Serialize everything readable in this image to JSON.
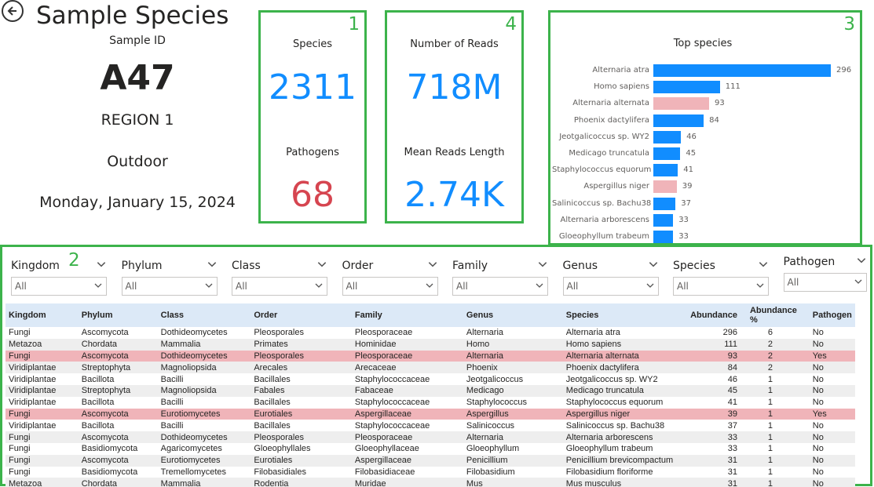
{
  "page": {
    "title": "Sample Species",
    "sample_id_label": "Sample ID",
    "sample_id": "A47",
    "region": "REGION 1",
    "environment": "Outdoor",
    "date": "Monday, January 15, 2024"
  },
  "cards": {
    "card1": {
      "number": "1",
      "species_label": "Species",
      "species_value": "2311",
      "pathogens_label": "Pathogens",
      "pathogens_value": "68"
    },
    "card4": {
      "number": "4",
      "reads_label": "Number of Reads",
      "reads_value": "718M",
      "length_label": "Mean Reads Length",
      "length_value": "2.74K"
    },
    "card3": {
      "number": "3"
    },
    "card2": {
      "number": "2"
    }
  },
  "colors": {
    "accent_green": "#3cb34b",
    "kpi_blue": "#118dff",
    "kpi_red": "#d64550",
    "bar_blue": "#118dff",
    "bar_pink": "#f0b4b9"
  },
  "chart_data": {
    "type": "bar",
    "orientation": "horizontal",
    "title": "Top species",
    "categories": [
      "Alternaria atra",
      "Homo sapiens",
      "Alternaria alternata",
      "Phoenix dactylifera",
      "Jeotgalicoccus sp. WY2",
      "Medicago truncatula",
      "Staphylococcus equorum",
      "Aspergillus niger",
      "Salinicoccus sp. Bachu38",
      "Alternaria arborescens",
      "Gloeophyllum trabeum"
    ],
    "values": [
      296,
      111,
      93,
      84,
      46,
      45,
      41,
      39,
      37,
      33,
      33
    ],
    "pathogen": [
      false,
      false,
      true,
      false,
      false,
      false,
      false,
      true,
      false,
      false,
      false
    ],
    "xlim": [
      0,
      296
    ]
  },
  "slicers": [
    {
      "label": "Kingdom",
      "value": "All"
    },
    {
      "label": "Phylum",
      "value": "All"
    },
    {
      "label": "Class",
      "value": "All"
    },
    {
      "label": "Order",
      "value": "All"
    },
    {
      "label": "Family",
      "value": "All"
    },
    {
      "label": "Genus",
      "value": "All"
    },
    {
      "label": "Species",
      "value": "All"
    },
    {
      "label": "Pathogen",
      "value": "All"
    }
  ],
  "table": {
    "headers": [
      "Kingdom",
      "Phylum",
      "Class",
      "Order",
      "Family",
      "Genus",
      "Species",
      "Abundance",
      "Abundance %",
      "Pathogen"
    ],
    "rows": [
      [
        "Fungi",
        "Ascomycota",
        "Dothideomycetes",
        "Pleosporales",
        "Pleosporaceae",
        "Alternaria",
        "Alternaria atra",
        "296",
        "6",
        "No"
      ],
      [
        "Metazoa",
        "Chordata",
        "Mammalia",
        "Primates",
        "Hominidae",
        "Homo",
        "Homo sapiens",
        "111",
        "2",
        "No"
      ],
      [
        "Fungi",
        "Ascomycota",
        "Dothideomycetes",
        "Pleosporales",
        "Pleosporaceae",
        "Alternaria",
        "Alternaria alternata",
        "93",
        "2",
        "Yes"
      ],
      [
        "Viridiplantae",
        "Streptophyta",
        "Magnoliopsida",
        "Arecales",
        "Arecaceae",
        "Phoenix",
        "Phoenix dactylifera",
        "84",
        "2",
        "No"
      ],
      [
        "Viridiplantae",
        "Bacillota",
        "Bacilli",
        "Bacillales",
        "Staphylococcaceae",
        "Jeotgalicoccus",
        "Jeotgalicoccus sp. WY2",
        "46",
        "1",
        "No"
      ],
      [
        "Viridiplantae",
        "Streptophyta",
        "Magnoliopsida",
        "Fabales",
        "Fabaceae",
        "Medicago",
        "Medicago truncatula",
        "45",
        "1",
        "No"
      ],
      [
        "Viridiplantae",
        "Bacillota",
        "Bacilli",
        "Bacillales",
        "Staphylococcaceae",
        "Staphylococcus",
        "Staphylococcus equorum",
        "41",
        "1",
        "No"
      ],
      [
        "Fungi",
        "Ascomycota",
        "Eurotiomycetes",
        "Eurotiales",
        "Aspergillaceae",
        "Aspergillus",
        "Aspergillus niger",
        "39",
        "1",
        "Yes"
      ],
      [
        "Viridiplantae",
        "Bacillota",
        "Bacilli",
        "Bacillales",
        "Staphylococcaceae",
        "Salinicoccus",
        "Salinicoccus sp. Bachu38",
        "37",
        "1",
        "No"
      ],
      [
        "Fungi",
        "Ascomycota",
        "Dothideomycetes",
        "Pleosporales",
        "Pleosporaceae",
        "Alternaria",
        "Alternaria arborescens",
        "33",
        "1",
        "No"
      ],
      [
        "Fungi",
        "Basidiomycota",
        "Agaricomycetes",
        "Gloeophyllales",
        "Gloeophyllaceae",
        "Gloeophyllum",
        "Gloeophyllum trabeum",
        "33",
        "1",
        "No"
      ],
      [
        "Fungi",
        "Ascomycota",
        "Eurotiomycetes",
        "Eurotiales",
        "Aspergillaceae",
        "Penicillium",
        "Penicillium brevicompactum",
        "31",
        "1",
        "No"
      ],
      [
        "Fungi",
        "Basidiomycota",
        "Tremellomycetes",
        "Filobasidiales",
        "Filobasidiaceae",
        "Filobasidium",
        "Filobasidium floriforme",
        "31",
        "1",
        "No"
      ],
      [
        "Metazoa",
        "Chordata",
        "Mammalia",
        "Rodentia",
        "Muridae",
        "Mus",
        "Mus musculus",
        "31",
        "1",
        "No"
      ]
    ]
  }
}
